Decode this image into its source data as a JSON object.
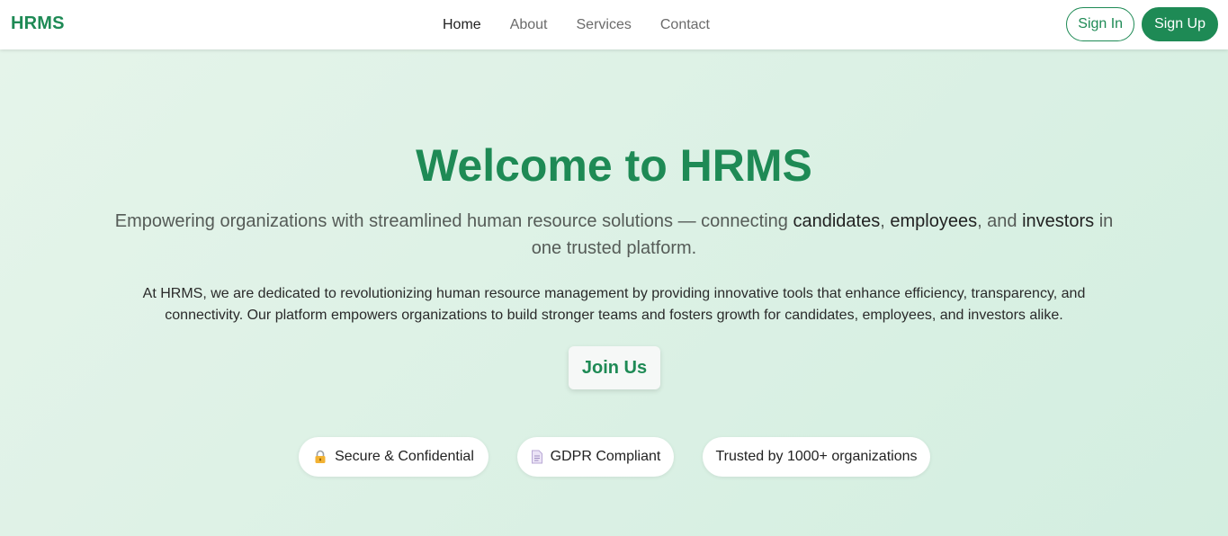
{
  "nav": {
    "brand": "HRMS",
    "links": [
      {
        "label": "Home"
      },
      {
        "label": "About"
      },
      {
        "label": "Services"
      },
      {
        "label": "Contact"
      }
    ],
    "sign_in": "Sign In",
    "sign_up": "Sign Up"
  },
  "hero": {
    "title": "Welcome to HRMS",
    "subtitle_parts": [
      "Empowering organizations with streamlined human resource solutions — connecting ",
      "candidates",
      ", ",
      "employees",
      ", and ",
      "investors",
      " in one trusted platform."
    ],
    "description": "At HRMS, we are dedicated to revolutionizing human resource management by providing innovative tools that enhance efficiency, transparency, and connectivity. Our platform empowers organizations to build stronger teams and fosters growth for candidates, employees, and investors alike.",
    "cta": "Join Us",
    "badges": [
      {
        "label": "Secure & Confidential",
        "icon": "lock-icon"
      },
      {
        "label": "GDPR Compliant",
        "icon": "document-icon"
      },
      {
        "label": "Trusted by 1000+ organizations",
        "icon": ""
      }
    ]
  },
  "colors": {
    "brand": "#1e8a55",
    "hero_bg_start": "#e5f4ea",
    "hero_bg_end": "#d3eee0"
  }
}
